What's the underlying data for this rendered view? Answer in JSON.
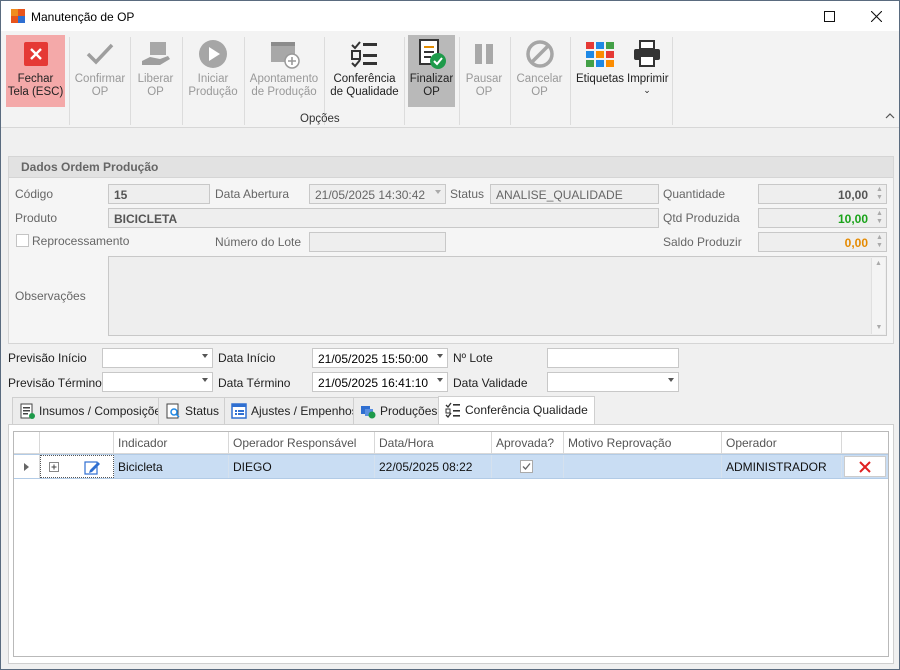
{
  "window": {
    "title": "Manutenção de OP"
  },
  "ribbon": {
    "buttons": [
      {
        "l1": "Fechar",
        "l2": "Tela (ESC)"
      },
      {
        "l1": "Confirmar",
        "l2": "OP"
      },
      {
        "l1": "Liberar",
        "l2": "OP"
      },
      {
        "l1": "Iniciar",
        "l2": "Produção"
      },
      {
        "l1": "Apontamento",
        "l2": "de Produção"
      },
      {
        "l1": "Conferência",
        "l2": "de Qualidade"
      },
      {
        "l1": "Finalizar",
        "l2": "OP"
      },
      {
        "l1": "Pausar",
        "l2": "OP"
      },
      {
        "l1": "Cancelar",
        "l2": "OP"
      },
      {
        "l1": "Etiquetas",
        "l2": ""
      },
      {
        "l1": "Imprimir",
        "l2": ""
      }
    ],
    "group_label": "Opções"
  },
  "panel": {
    "title": "Dados Ordem Produção",
    "codigo_label": "Código",
    "codigo": "15",
    "data_abertura_label": "Data Abertura",
    "data_abertura": "21/05/2025 14:30:42",
    "status_label": "Status",
    "status": "ANALISE_QUALIDADE",
    "quantidade_label": "Quantidade",
    "quantidade": "10,00",
    "produto_label": "Produto",
    "produto": "BICICLETA",
    "qtd_produzida_label": "Qtd Produzida",
    "qtd_produzida": "10,00",
    "reprocessamento_label": "Reprocessamento",
    "numero_lote_label": "Número do Lote",
    "numero_lote": "",
    "saldo_label": "Saldo Produzir",
    "saldo": "0,00",
    "observacoes_label": "Observações"
  },
  "form": {
    "previsao_inicio_label": "Previsão Início",
    "previsao_inicio": "",
    "data_inicio_label": "Data Início",
    "data_inicio": "21/05/2025 15:50:00",
    "n_lote_label": "Nº Lote",
    "n_lote": "",
    "previsao_termino_label": "Previsão Término",
    "previsao_termino": "",
    "data_termino_label": "Data Término",
    "data_termino": "21/05/2025 16:41:10",
    "data_validade_label": "Data Validade",
    "data_validade": ""
  },
  "tabs": [
    {
      "label": "Insumos / Composições"
    },
    {
      "label": "Status"
    },
    {
      "label": "Ajustes / Empenhos"
    },
    {
      "label": "Produções"
    },
    {
      "label": "Conferência Qualidade"
    }
  ],
  "grid": {
    "columns": [
      "Indicador",
      "Operador Responsável",
      "Data/Hora",
      "Aprovada?",
      "Motivo Reprovação",
      "Operador"
    ],
    "rows": [
      {
        "indicador": "Bicicleta",
        "operador_responsavel": "DIEGO",
        "data_hora": "22/05/2025 08:22",
        "aprovada": true,
        "motivo": "",
        "operador": "ADMINISTRADOR"
      }
    ]
  },
  "colors": {
    "fechar_bg": "#f4a9a9",
    "finalizar_bg": "#b9b9b9",
    "row_selected": "#c9ddf3",
    "green_value": "#1aa31a",
    "orange_value": "#e58a00",
    "delete_red": "#e02020"
  }
}
